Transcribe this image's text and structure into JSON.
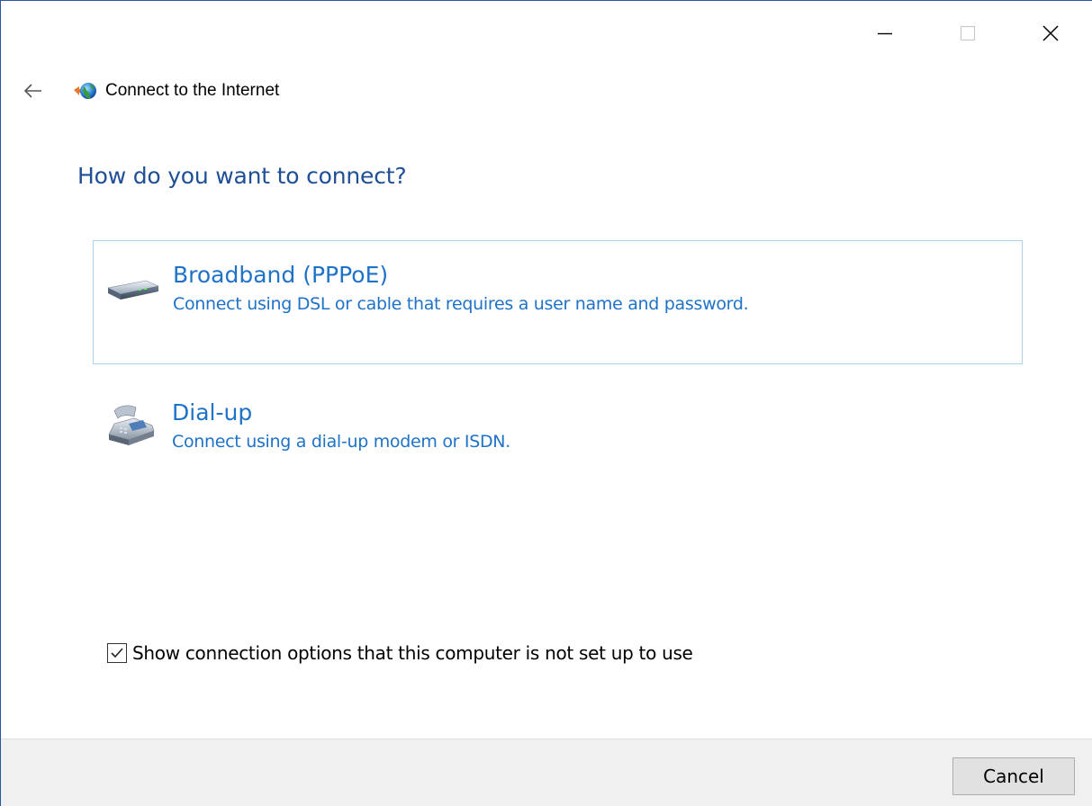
{
  "window": {
    "title": "Connect to the Internet",
    "controls": {
      "minimize_icon": "minimize-icon",
      "maximize_icon": "maximize-icon",
      "close_icon": "close-icon"
    }
  },
  "navigation": {
    "back_icon": "back-arrow-icon",
    "app_icon": "network-globe-icon"
  },
  "main": {
    "heading": "How do you want to connect?",
    "options": [
      {
        "title": "Broadband (PPPoE)",
        "description": "Connect using DSL or cable that requires a user name and password.",
        "icon": "broadband-modem-icon",
        "selected": true
      },
      {
        "title": "Dial-up",
        "description": "Connect using a dial-up modem or ISDN.",
        "icon": "telephone-modem-icon",
        "selected": false
      }
    ],
    "show_options_checkbox": {
      "label": "Show connection options that this computer is not set up to use",
      "checked": true
    }
  },
  "footer": {
    "cancel_label": "Cancel"
  },
  "colors": {
    "heading": "#1f4f96",
    "link": "#1e72c7",
    "selection_border": "#a9d3ef",
    "footer_bg": "#f0f0f0",
    "window_border": "#2b579a"
  }
}
